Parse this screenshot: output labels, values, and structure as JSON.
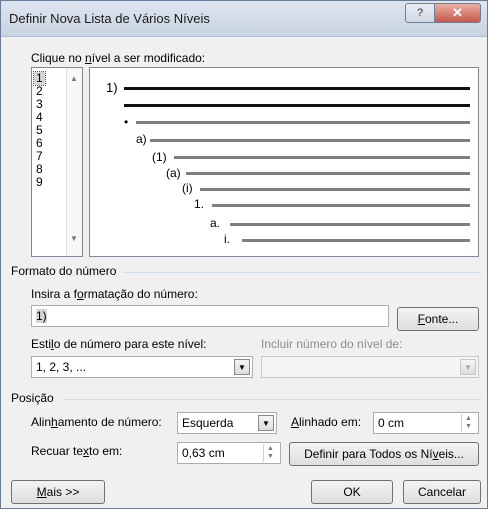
{
  "window": {
    "title": "Definir Nova Lista de Vários Níveis",
    "help_label": "?",
    "close_label": "✕"
  },
  "levels": {
    "label_pre": "Clique no ",
    "label_u": "n",
    "label_post": "ível a ser modificado:",
    "items": [
      "1",
      "2",
      "3",
      "4",
      "5",
      "6",
      "7",
      "8",
      "9"
    ],
    "selected": "1"
  },
  "preview": {
    "markers": [
      "1)",
      "",
      "•",
      "a)",
      "(1)",
      "(a)",
      "(i)",
      "1.",
      "a.",
      "i."
    ]
  },
  "number_format": {
    "section_title": "Formato do número",
    "input_label_pre": "Insira a f",
    "input_label_u": "o",
    "input_label_post": "rmatação do número:",
    "input_value": "1)",
    "font_button_u": "F",
    "font_button_rest": "onte...",
    "style_label_pre": "Esti",
    "style_label_u": "l",
    "style_label_post": "o de número para este nível:",
    "style_value": "1, 2, 3, ...",
    "include_label": "Incluir número do nível de:",
    "include_value": ""
  },
  "position": {
    "section_title": "Posição",
    "alignment_label_pre": "Alin",
    "alignment_label_u": "h",
    "alignment_label_post": "amento de número:",
    "alignment_value": "Esquerda",
    "aligned_at_label_u": "A",
    "aligned_at_label_post": "linhado em:",
    "aligned_at_value": "0 cm",
    "indent_label_pre": "Recuar te",
    "indent_label_u": "x",
    "indent_label_post": "to em:",
    "indent_value": "0,63 cm",
    "set_all_pre": "Definir para Todos os Ní",
    "set_all_u": "v",
    "set_all_post": "eis..."
  },
  "footer": {
    "more_u": "M",
    "more_rest": "ais >>",
    "ok": "OK",
    "cancel": "Cancelar"
  }
}
